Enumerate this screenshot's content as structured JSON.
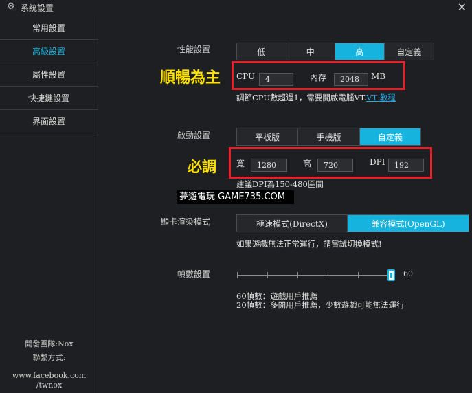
{
  "window": {
    "title": "系統設置",
    "close_glyph": "✕",
    "gear_glyph": "⚙"
  },
  "sidebar": {
    "items": [
      {
        "label": "常用設置",
        "active": false
      },
      {
        "label": "高級設置",
        "active": true
      },
      {
        "label": "屬性設置",
        "active": false
      },
      {
        "label": "快捷鍵設置",
        "active": false
      },
      {
        "label": "界面設置",
        "active": false
      }
    ],
    "footer": {
      "team": "開發團隊:Nox",
      "contact": "聯繫方式:",
      "url_line1": "www.facebook.com",
      "url_line2": "/twnox"
    }
  },
  "performance": {
    "label": "性能設置",
    "options": [
      "低",
      "中",
      "高",
      "自定義"
    ],
    "selected": "高",
    "cpu_label": "CPU",
    "cpu_value": "4",
    "mem_label": "內存",
    "mem_value": "2048",
    "mem_unit": "MB",
    "hint_text": "調節CPU數超過1，需要開啟電腦VT.",
    "hint_link": "VT 教程",
    "annotation": "順暢為主"
  },
  "startup": {
    "label": "啟動設置",
    "options": [
      "平板版",
      "手機版",
      "自定義"
    ],
    "selected": "自定義",
    "width_label": "寬",
    "width_value": "1280",
    "height_label": "高",
    "height_value": "720",
    "dpi_label": "DPI",
    "dpi_value": "192",
    "hint": "建議DPI為150-480區間",
    "annotation": "必調"
  },
  "watermark": "夢遊電玩 GAME735.COM",
  "render": {
    "label": "顯卡渲染模式",
    "options": [
      "極速模式(DirectX)",
      "兼容模式(OpenGL)"
    ],
    "selected": "兼容模式(OpenGL)",
    "hint": "如果遊戲無法正常運行，請嘗試切換模式!"
  },
  "fps": {
    "label": "幀數設置",
    "value": 60,
    "value_label": "60",
    "fraction": 1.0,
    "note1": "60幀數：遊戲用戶推薦",
    "note2": "20幀數：多開用戶推薦，少數遊戲可能無法運行"
  },
  "colors": {
    "accent": "#16b3de",
    "annotation": "#ffe200",
    "highlight_box": "#e1222a",
    "background": "#1e1f22"
  }
}
